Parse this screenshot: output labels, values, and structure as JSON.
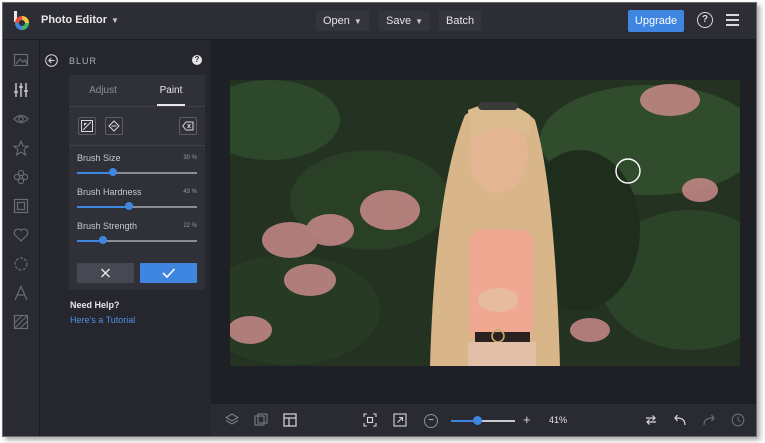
{
  "header": {
    "app_title": "Photo Editor",
    "menu": {
      "open": "Open",
      "save": "Save",
      "batch": "Batch"
    },
    "upgrade": "Upgrade",
    "help_glyph": "?"
  },
  "rail": {
    "icons": [
      "image-icon",
      "adjustments-icon",
      "eye-icon",
      "star-icon",
      "flower-icon",
      "frame-icon",
      "heart-icon",
      "shape-icon",
      "text-icon",
      "texture-icon"
    ]
  },
  "panel": {
    "title": "BLUR",
    "help_glyph": "?",
    "tabs": [
      {
        "label": "Adjust",
        "active": false
      },
      {
        "label": "Paint",
        "active": true
      }
    ],
    "sliders": [
      {
        "label": "Brush Size",
        "value_text": "30 %",
        "value": 30
      },
      {
        "label": "Brush Hardness",
        "value_text": "43 %",
        "value": 43
      },
      {
        "label": "Brush Strength",
        "value_text": "22 %",
        "value": 22
      }
    ],
    "need_help": "Need Help?",
    "tutorial": "Here's a Tutorial"
  },
  "bottombar": {
    "zoom_text": "41%",
    "zoom_value": 41,
    "zoom_minus": "−",
    "zoom_plus": "+"
  },
  "colors": {
    "accent": "#3f86e0",
    "bg": "#26272e"
  }
}
